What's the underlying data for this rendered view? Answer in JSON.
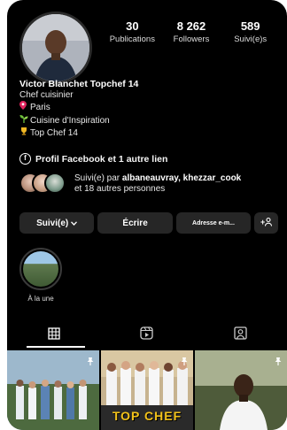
{
  "profile": {
    "stats": [
      {
        "value": "30",
        "label": "Publications"
      },
      {
        "value": "8 262",
        "label": "Followers"
      },
      {
        "value": "589",
        "label": "Suivi(e)s"
      }
    ],
    "name": "Victor Blanchet Topchef 14",
    "category": "Chef cuisinier",
    "bio_lines": [
      {
        "icon": "pin-icon",
        "text": "Paris"
      },
      {
        "icon": "seedling-icon",
        "text": "Cuisine d'Inspiration"
      },
      {
        "icon": "trophy-icon",
        "text": "Top Chef 14"
      }
    ],
    "links_text": "Profil Facebook et 1 autre lien",
    "followed_by": {
      "prefix": "Suivi(e) par ",
      "names": "albaneauvray, khezzar_cook",
      "suffix": "et 18 autres personnes"
    }
  },
  "actions": {
    "following": "Suivi(e)",
    "message": "Écrire",
    "email": "Adresse e-m...",
    "add_user": "+"
  },
  "highlights": [
    {
      "label": "À la une"
    }
  ],
  "tabs": [
    "grid-icon",
    "reels-icon",
    "tagged-icon"
  ],
  "grid_posts": [
    {
      "overlay_text": ""
    },
    {
      "overlay_text": "TOP CHEF"
    },
    {
      "overlay_text": ""
    }
  ],
  "colors": {
    "background": "#000000",
    "text": "#f5f5f5",
    "button": "#262626"
  }
}
